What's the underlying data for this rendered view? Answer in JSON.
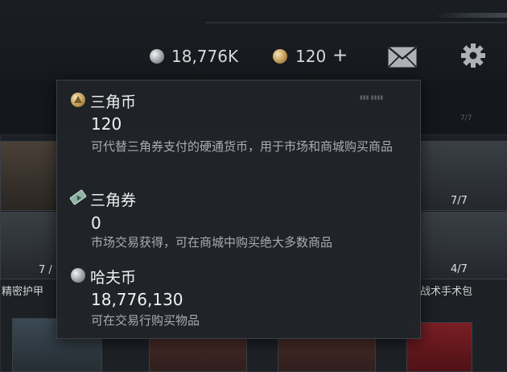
{
  "header": {
    "haf_balance": "18,776K",
    "triangle_coin_balance": "120",
    "add_symbol": "+"
  },
  "background": {
    "left_row_count": "7 /",
    "right_count_top": "7/7",
    "right_count_bottom": "4/7",
    "left_item_label": "精密护甲",
    "right_item_label": "战术手术包",
    "top_left_count": "7/7"
  },
  "popup": {
    "sections": [
      {
        "title": "三角币",
        "value": "120",
        "desc": "可代替三角券支付的硬通货币，用于市场和商城购买商品",
        "icon": "triangle-coin-icon"
      },
      {
        "title": "三角券",
        "value": "0",
        "desc": "市场交易获得，可在商城中购买绝大多数商品",
        "icon": "triangle-ticket-icon"
      },
      {
        "title": "哈夫币",
        "value": "18,776,130",
        "desc": "可在交易行购买物品",
        "icon": "haf-coin-icon"
      }
    ]
  },
  "colors": {
    "background": "#14171b",
    "popup_bg": "#202328",
    "text_primary": "#f0f0f0",
    "text_secondary": "#a9adb2",
    "medkit_red": "#b8202a"
  }
}
